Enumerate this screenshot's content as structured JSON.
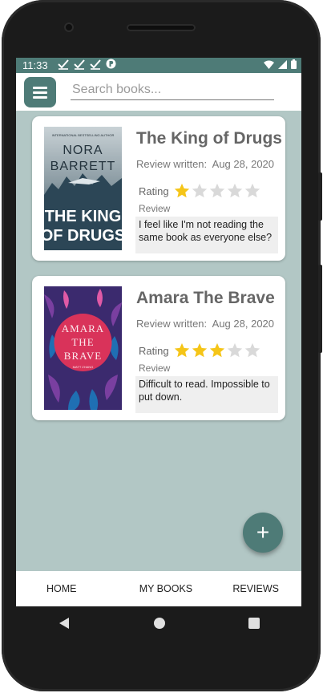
{
  "status": {
    "time": "11:33"
  },
  "search": {
    "placeholder": "Search books..."
  },
  "books": [
    {
      "title": "The King of Drugs",
      "review_written_label": "Review written:",
      "review_date": "Aug 28, 2020",
      "rating_label": "Rating",
      "rating": 1,
      "rating_max": 5,
      "review_label": "Review",
      "review_text": "I feel like I'm not reading the same book as everyone else?",
      "cover": {
        "tagline": "INTERNATIONAL BESTSELLING AUTHOR",
        "author_first": "NORA",
        "author_last": "BARRETT",
        "title_line1": "THE KING",
        "title_line2": "OF DRUGS"
      }
    },
    {
      "title": "Amara The Brave",
      "review_written_label": "Review written:",
      "review_date": "Aug 28, 2020",
      "rating_label": "Rating",
      "rating": 3,
      "rating_max": 5,
      "review_label": "Review",
      "review_text": "Difficult to read. Impossible to put down.",
      "cover": {
        "title_line1": "AMARA",
        "title_line2": "THE",
        "title_line3": "BRAVE",
        "author": "MATT ZHANG"
      }
    }
  ],
  "fab": {
    "label": "+"
  },
  "bottom_nav": {
    "home": "HOME",
    "my_books": "MY BOOKS",
    "reviews": "REVIEWS"
  },
  "colors": {
    "primary": "#4e7b77",
    "background": "#b2c7c5",
    "star_filled": "#f5c518",
    "star_empty": "#d9d9d9"
  },
  "icons": [
    "menu-icon",
    "check-icon",
    "wifi-icon",
    "signal-icon",
    "battery-icon",
    "plus-icon",
    "back-icon",
    "home-icon",
    "recents-icon"
  ]
}
